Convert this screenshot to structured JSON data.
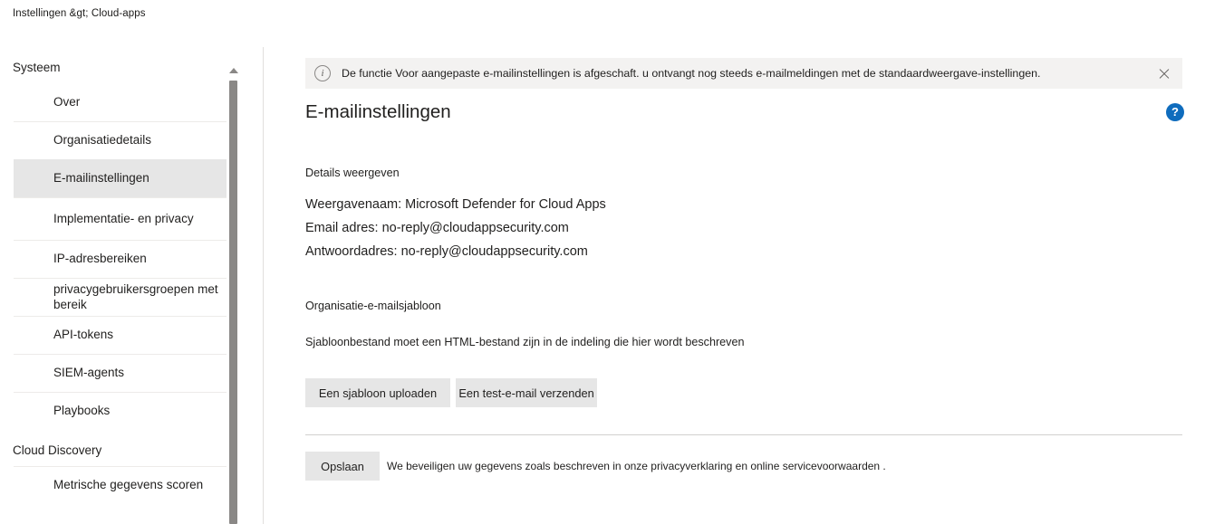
{
  "breadcrumb": "Instellingen &gt; Cloud-apps",
  "sidebar": {
    "groups": [
      {
        "title": "Systeem",
        "items": [
          {
            "label": "Over",
            "selected": false,
            "first": true
          },
          {
            "label": "Organisatiedetails",
            "selected": false
          },
          {
            "label": "E-mailinstellingen",
            "selected": true
          },
          {
            "label": "Implementatie- en privacy",
            "selected": false,
            "tall": true
          },
          {
            "label": "IP-adresbereiken",
            "selected": false
          },
          {
            "label": "privacygebruikersgroepen met bereik",
            "selected": false
          },
          {
            "label": "API-tokens",
            "selected": false
          },
          {
            "label": "SIEM-agents",
            "selected": false
          },
          {
            "label": "Playbooks",
            "selected": false
          }
        ]
      },
      {
        "title": "Cloud Discovery",
        "items": [
          {
            "label": "Metrische gegevens scoren",
            "selected": false
          }
        ]
      }
    ]
  },
  "banner": {
    "icon": "info-icon",
    "text": "De functie Voor aangepaste e-mailinstellingen is afgeschaft. u ontvangt nog steeds e-mailmeldingen met de standaardweergave-instellingen.",
    "close_icon": "close-icon",
    "background": "#f3f2f1"
  },
  "page": {
    "title": "E-mailinstellingen",
    "help_icon": "?",
    "help_color": "#0f6cbd"
  },
  "details": {
    "section_label": "Details weergeven",
    "display_name_label": "Weergavenaam:",
    "display_name_value": "Microsoft Defender for Cloud Apps",
    "email_line": "Email adres: no-reply@cloudappsecurity.com",
    "reply_line": "Antwoordadres: no-reply@cloudappsecurity.com"
  },
  "template": {
    "section_label": "Organisatie-e-mailsjabloon",
    "description": "Sjabloonbestand moet een HTML-bestand zijn in de indeling die hier wordt beschreven",
    "upload_button": "Een sjabloon uploaden",
    "test_button": "Een test-e-mail verzenden"
  },
  "footer": {
    "save_button": "Opslaan",
    "privacy_note": "We beveiligen uw gegevens zoals beschreven in onze privacyverklaring en online servicevoorwaarden ."
  }
}
